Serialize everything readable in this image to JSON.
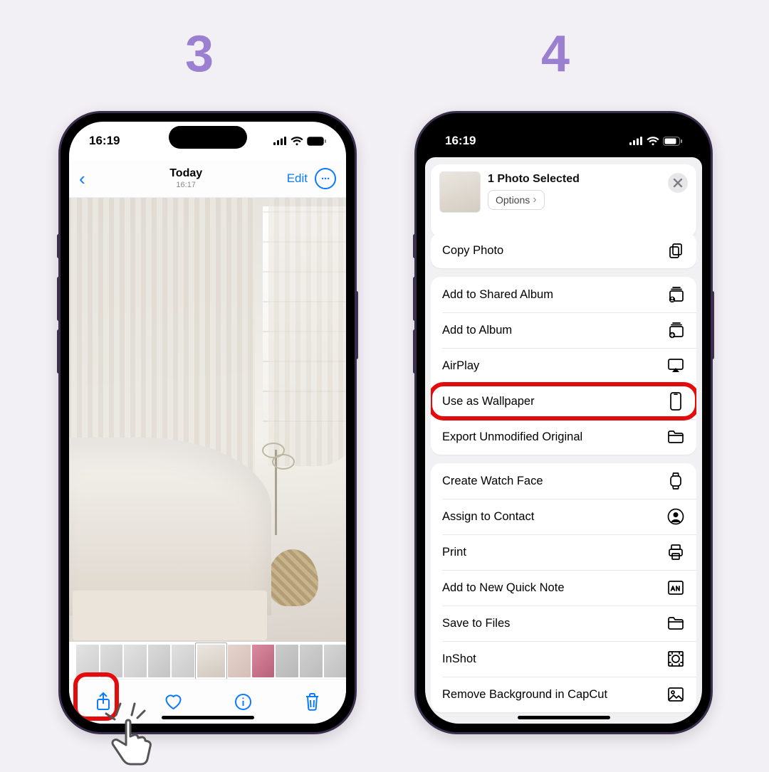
{
  "steps": {
    "left": "3",
    "right": "4"
  },
  "status": {
    "time": "16:19"
  },
  "p1": {
    "nav": {
      "title": "Today",
      "subtitle": "16:17",
      "edit": "Edit"
    }
  },
  "p2": {
    "header": {
      "title": "1 Photo Selected",
      "options": "Options"
    },
    "actions": {
      "g1": [
        {
          "label": "Copy Photo",
          "icon": "copy"
        }
      ],
      "g2": [
        {
          "label": "Add to Shared Album",
          "icon": "shared-album"
        },
        {
          "label": "Add to Album",
          "icon": "album"
        },
        {
          "label": "AirPlay",
          "icon": "airplay"
        },
        {
          "label": "Use as Wallpaper",
          "icon": "phone",
          "highlight": true
        },
        {
          "label": "Export Unmodified Original",
          "icon": "folder"
        }
      ],
      "g3": [
        {
          "label": "Create Watch Face",
          "icon": "watch"
        },
        {
          "label": "Assign to Contact",
          "icon": "contact"
        },
        {
          "label": "Print",
          "icon": "print"
        },
        {
          "label": "Add to New Quick Note",
          "icon": "note"
        },
        {
          "label": "Save to Files",
          "icon": "folder"
        },
        {
          "label": "InShot",
          "icon": "inshot"
        },
        {
          "label": "Remove Background in CapCut",
          "icon": "image"
        }
      ]
    }
  }
}
